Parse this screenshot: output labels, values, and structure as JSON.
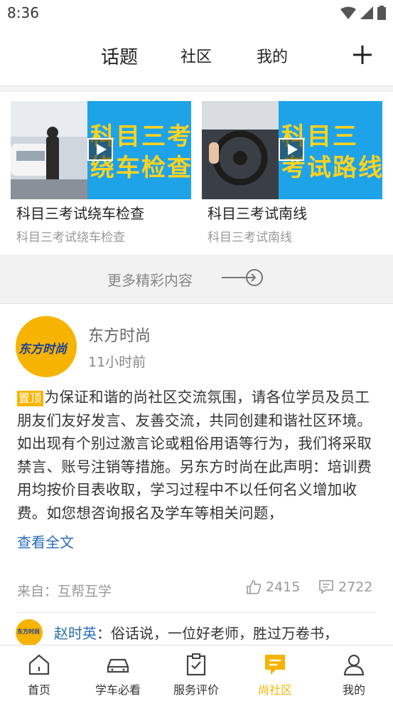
{
  "status": {
    "time": "8:36"
  },
  "topnav": {
    "tabs": [
      "话题",
      "社区",
      "我的"
    ]
  },
  "videos": [
    {
      "thumb_text": "科目三考\n绕车检查",
      "title": "科目三考试绕车检查",
      "subtitle": "科目三考试绕车检查"
    },
    {
      "thumb_text": "科目三\n考试路线",
      "title": "科目三考试南线",
      "subtitle": "科目三考试南线"
    }
  ],
  "more_content": "更多精彩内容",
  "post": {
    "avatar_text": "东方时尚",
    "author": "东方时尚",
    "time_ago": "11小时前",
    "pin_label": "置顶",
    "body": "为保证和谐的尚社区交流氛围，请各位学员及员工朋友们友好发言、友善交流，共同创建和谐社区环境。如出现有个别过激言论或粗俗用语等行为，我们将采取禁言、账号注销等措施。另东方时尚在此声明：培训费用均按价目表收取，学习过程中不以任何名义增加收费。如您想咨询报名及学车等相关问题，",
    "read_more": "查看全文",
    "source": "来自：互帮互学",
    "likes": "2415",
    "comments": "2722"
  },
  "reply": {
    "avatar_text": "东方时尚",
    "name": "赵时英",
    "text": "：俗话说，一位好老师，胜过万卷书，"
  },
  "bottomnav": {
    "items": [
      "首页",
      "学车必看",
      "服务评价",
      "尚社区",
      "我的"
    ],
    "active_index": 3
  },
  "colors": {
    "accent": "#f6b400",
    "link": "#2a6db8",
    "thumb_bg": "#1ea3e8",
    "thumb_text": "#ffd21f"
  }
}
